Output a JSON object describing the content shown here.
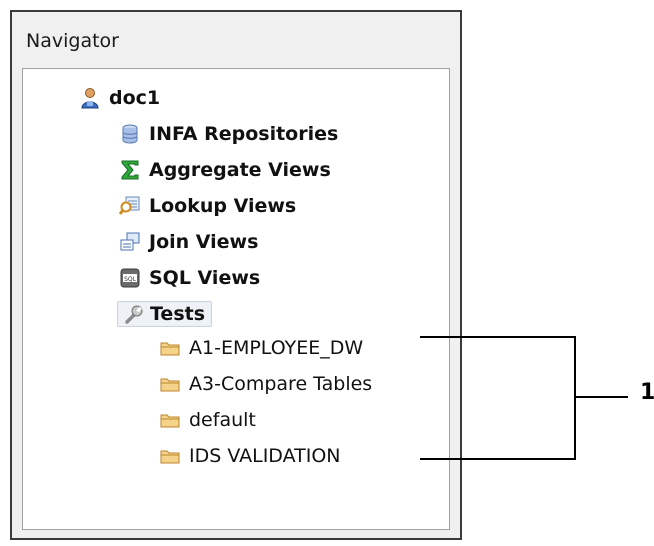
{
  "panel": {
    "title": "Navigator"
  },
  "tree": {
    "root": {
      "label": "doc1",
      "icon": "user-icon"
    },
    "items": [
      {
        "label": "INFA Repositories",
        "icon": "database-icon"
      },
      {
        "label": "Aggregate Views",
        "icon": "sigma-icon"
      },
      {
        "label": "Lookup Views",
        "icon": "lookup-icon"
      },
      {
        "label": "Join Views",
        "icon": "join-icon"
      },
      {
        "label": "SQL Views",
        "icon": "sql-icon"
      },
      {
        "label": "Tests",
        "icon": "wrench-icon",
        "selected": true
      }
    ],
    "test_folders": [
      {
        "label": "A1-EMPLOYEE_DW",
        "icon": "folder-icon"
      },
      {
        "label": "A3-Compare Tables",
        "icon": "folder-icon"
      },
      {
        "label": "default",
        "icon": "folder-icon"
      },
      {
        "label": "IDS VALIDATION",
        "icon": "folder-icon"
      }
    ]
  },
  "callout": {
    "label": "1"
  },
  "colors": {
    "folder": "#e8b24a",
    "selection_bg": "#eef2f6",
    "selection_border": "#c9d3de"
  }
}
